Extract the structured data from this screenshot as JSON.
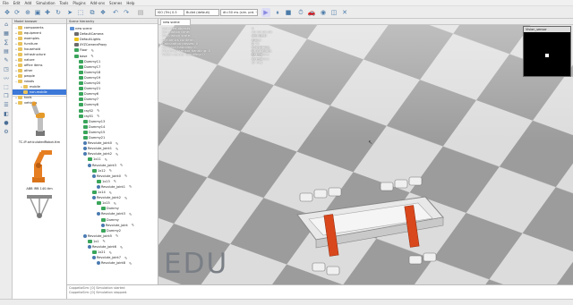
{
  "menu": [
    "File",
    "Edit",
    "Add",
    "Simulation",
    "Tools",
    "Plugins",
    "Add-ons",
    "Scenes",
    "Help"
  ],
  "toolbar": {
    "camera_select": "ISO (Trk) 0.5",
    "dyn_engine": "Bullet (default)",
    "dt_select": "dt=50 ms (sim. prd. ~0.5"
  },
  "model_browser": {
    "title": "Model browser",
    "folders": [
      {
        "label": "components",
        "indent": 0,
        "open": true
      },
      {
        "label": "equipment",
        "indent": 0
      },
      {
        "label": "examples",
        "indent": 0
      },
      {
        "label": "furniture",
        "indent": 0
      },
      {
        "label": "household",
        "indent": 0
      },
      {
        "label": "infrastructure",
        "indent": 0
      },
      {
        "label": "nature",
        "indent": 0
      },
      {
        "label": "office items",
        "indent": 0
      },
      {
        "label": "other",
        "indent": 0
      },
      {
        "label": "people",
        "indent": 0
      },
      {
        "label": "robots",
        "indent": 0,
        "open": true
      },
      {
        "label": "mobile",
        "indent": 1
      },
      {
        "label": "non-mobile",
        "indent": 1,
        "selected": true
      },
      {
        "label": "tools",
        "indent": 0
      },
      {
        "label": "vehicles",
        "indent": 0
      }
    ],
    "thumbs": [
      "TC-IP-articulatedRobot.ttm",
      "ABB IRB 140.ttm"
    ]
  },
  "scene_hierarchy": {
    "tab": "Scene hierarchy",
    "rows": [
      {
        "label": "new scene",
        "indent": 0,
        "icon": "scene"
      },
      {
        "label": "DefaultCamera",
        "indent": 1,
        "icon": "camera"
      },
      {
        "label": "DefaultLights",
        "indent": 1,
        "icon": "light"
      },
      {
        "label": "XYZCameraProxy",
        "indent": 1,
        "icon": "camera"
      },
      {
        "label": "Floor",
        "indent": 1,
        "icon": "shape"
      },
      {
        "label": "base",
        "indent": 1,
        "icon": "shape"
      },
      {
        "label": "Dummy11",
        "indent": 2,
        "icon": "dummy"
      },
      {
        "label": "Dummy17",
        "indent": 2,
        "icon": "dummy"
      },
      {
        "label": "Dummy18",
        "indent": 2,
        "icon": "dummy"
      },
      {
        "label": "Dummy19",
        "indent": 2,
        "icon": "dummy"
      },
      {
        "label": "Dummy20",
        "indent": 2,
        "icon": "dummy"
      },
      {
        "label": "Dummy21",
        "indent": 2,
        "icon": "dummy"
      },
      {
        "label": "Dummy6",
        "indent": 2,
        "icon": "dummy"
      },
      {
        "label": "Dummy7",
        "indent": 2,
        "icon": "dummy"
      },
      {
        "label": "Dummy8",
        "indent": 2,
        "icon": "dummy"
      },
      {
        "label": "ray02",
        "indent": 2,
        "icon": "shape"
      },
      {
        "label": "ray01",
        "indent": 2,
        "icon": "shape"
      },
      {
        "label": "Dummy13",
        "indent": 3,
        "icon": "dummy"
      },
      {
        "label": "Dummy14",
        "indent": 3,
        "icon": "dummy"
      },
      {
        "label": "Dummy15",
        "indent": 3,
        "icon": "dummy"
      },
      {
        "label": "Dummy21",
        "indent": 3,
        "icon": "dummy"
      },
      {
        "label": "Revolute_joint0",
        "indent": 3,
        "icon": "joint"
      },
      {
        "label": "Revolute_joint1",
        "indent": 3,
        "icon": "joint"
      },
      {
        "label": "Revolute_joint2",
        "indent": 3,
        "icon": "joint"
      },
      {
        "label": "1x11",
        "indent": 4,
        "icon": "shape"
      },
      {
        "label": "Revolute_joint3",
        "indent": 4,
        "icon": "joint"
      },
      {
        "label": "1x12",
        "indent": 5,
        "icon": "shape"
      },
      {
        "label": "Revolute_joint0",
        "indent": 5,
        "icon": "joint"
      },
      {
        "label": "1x13",
        "indent": 6,
        "icon": "shape"
      },
      {
        "label": "Revolute_joint1",
        "indent": 6,
        "icon": "joint"
      },
      {
        "label": "1x14",
        "indent": 5,
        "icon": "shape"
      },
      {
        "label": "Revolute_joint2",
        "indent": 5,
        "icon": "joint"
      },
      {
        "label": "1x15",
        "indent": 6,
        "icon": "shape"
      },
      {
        "label": "Dummy",
        "indent": 7,
        "icon": "dummy"
      },
      {
        "label": "Revolute_joint3",
        "indent": 6,
        "icon": "joint"
      },
      {
        "label": "Dummy",
        "indent": 7,
        "icon": "dummy"
      },
      {
        "label": "Revolute_joint",
        "indent": 7,
        "icon": "joint"
      },
      {
        "label": "Dummy2",
        "indent": 7,
        "icon": "dummy"
      },
      {
        "label": "Revolute_joint5",
        "indent": 3,
        "icon": "joint"
      },
      {
        "label": "1x1",
        "indent": 4,
        "icon": "shape"
      },
      {
        "label": "Revolute_joint6",
        "indent": 4,
        "icon": "joint"
      },
      {
        "label": "1x21",
        "indent": 5,
        "icon": "shape"
      },
      {
        "label": "Revolute_joint7",
        "indent": 5,
        "icon": "joint"
      },
      {
        "label": "Revolute_joint8",
        "indent": 6,
        "icon": "joint"
      }
    ]
  },
  "viewport": {
    "info_rows": [
      {
        "label": "Selected objects:",
        "value": "0"
      },
      {
        "label": "Simulation time:",
        "value": "00:00:00.00 (dt=50.0 ms)"
      },
      {
        "label": "Simulation state:",
        "value": "stopped"
      },
      {
        "label": "Dynamics content:",
        "value": "Bullet 2.78"
      },
      {
        "label": "Calculation passes: 0",
        "value": "0 detections, 0 collisions (0 ms)"
      },
      {
        "label": "Collision handling: 0",
        "value": "0 distance calculations (0 ms)"
      },
      {
        "label": "Proximity sensor handling: 0",
        "value": "0 detections (0 ms)"
      },
      {
        "label": "Vision sensor handling: 0",
        "value": "0 detections (0 ms)"
      }
    ],
    "sensor_title": "Vision_sensor",
    "watermark": "EDU"
  },
  "console": [
    "CoppeliaSim: [0] Simulation started",
    "CoppeliaSim: [0] Simulation stopped."
  ]
}
